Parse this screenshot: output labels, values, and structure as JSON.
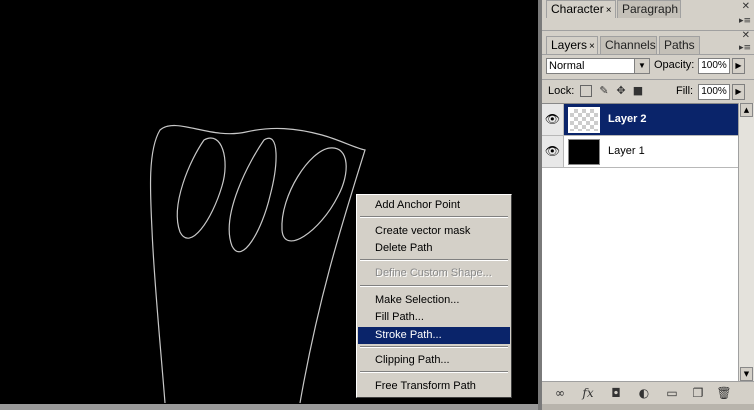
{
  "context_menu": {
    "items": [
      {
        "label": "Add Anchor Point",
        "enabled": true
      },
      {
        "label": "Create vector mask",
        "enabled": true
      },
      {
        "label": "Delete Path",
        "enabled": true
      },
      {
        "label": "Define Custom Shape...",
        "enabled": false
      },
      {
        "label": "Make Selection...",
        "enabled": true
      },
      {
        "label": "Fill Path...",
        "enabled": true
      },
      {
        "label": "Stroke Path...",
        "enabled": true,
        "highlighted": true
      },
      {
        "label": "Clipping Path...",
        "enabled": true
      },
      {
        "label": "Free Transform Path",
        "enabled": true
      }
    ]
  },
  "top_panel": {
    "tabs": [
      {
        "label": "Character",
        "close": "×"
      },
      {
        "label": "Paragraph"
      }
    ]
  },
  "layers_panel": {
    "tabs": [
      {
        "label": "Layers",
        "close": "×"
      },
      {
        "label": "Channels"
      },
      {
        "label": "Paths"
      }
    ],
    "blend_mode": "Normal",
    "opacity_label": "Opacity:",
    "opacity_value": "100%",
    "lock_label": "Lock:",
    "fill_label": "Fill:",
    "fill_value": "100%",
    "layers": [
      {
        "name": "Layer 2",
        "selected": true,
        "thumbnail": "transparent"
      },
      {
        "name": "Layer 1",
        "selected": false,
        "thumbnail": "black"
      }
    ],
    "bottom_icons": [
      "link-icon",
      "fx-icon",
      "mask-icon",
      "adjustment-icon",
      "folder-icon",
      "new-layer-icon",
      "trash-icon"
    ],
    "fx_label": "fx"
  },
  "colors": {
    "highlight": "#0a246a",
    "panel_bg": "#d4d0c8",
    "canvas_bg": "#000000",
    "path_stroke": "#c8c8c8"
  }
}
